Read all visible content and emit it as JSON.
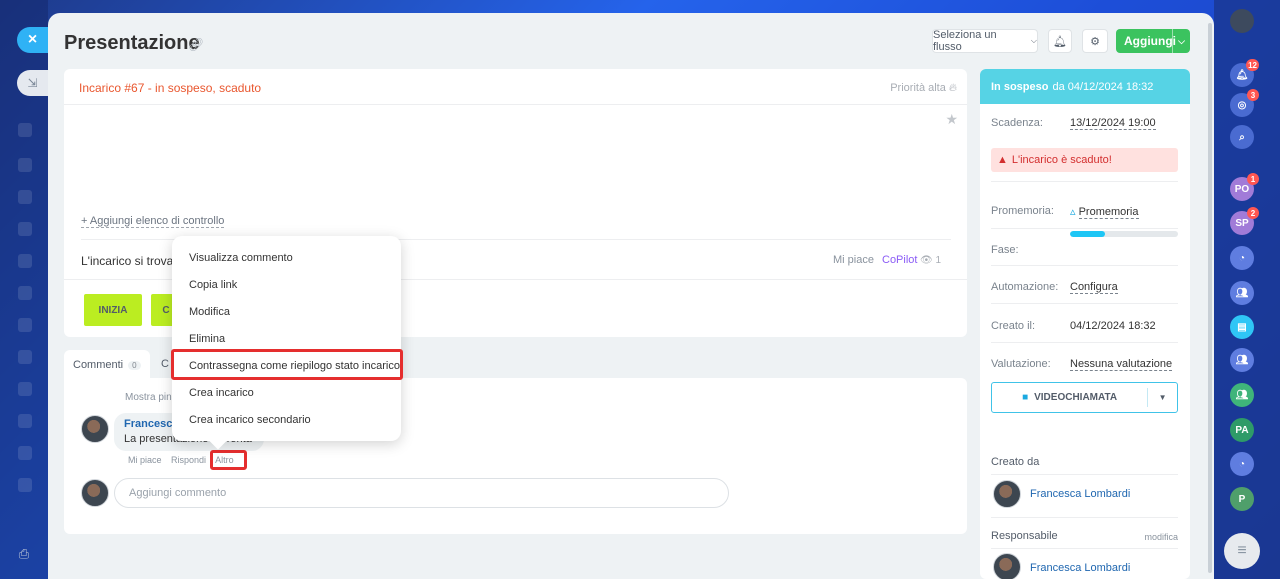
{
  "window": {
    "close_icon": "close-icon",
    "collapse_icon": "collapse-icon"
  },
  "header": {
    "title": "Presentazione",
    "flow_select": "Seleziona un flusso",
    "add_label": "Aggiungi"
  },
  "task": {
    "state": "Incarico #67 - in sospeso, scaduto",
    "priority": "Priorità alta",
    "checklist_link": "+ Aggiungi elenco di controllo",
    "status_text": "L'incarico si trova n",
    "likes": "Mi piace",
    "copilot": "CoPilot",
    "views": "1",
    "start_button": "INIZIA",
    "second_button": "C"
  },
  "context_menu": {
    "items": [
      "Visualizza commento",
      "Copia link",
      "Modifica",
      "Elimina",
      "Contrassegna come riepilogo stato incarico",
      "Crea incarico",
      "Crea incarico secondario"
    ]
  },
  "comments": {
    "tab_label": "Commenti",
    "tab_count": "0",
    "tab_other": "C",
    "show_pinned": "Mostra pin",
    "author": "Francesca",
    "text": "La presentazione è p",
    "text_tail": "ronta",
    "actions": {
      "like": "Mi piace",
      "reply": "Rispondi",
      "more": "Altro"
    },
    "input_placeholder": "Aggiungi commento"
  },
  "sidebar": {
    "status_bold": "In sospeso",
    "status_rest": "da 04/12/2024 18:32",
    "deadline_label": "Scadenza:",
    "deadline_value": "13/12/2024 19:00",
    "overdue": "L'incarico è scaduto!",
    "reminder_label": "Promemoria:",
    "reminder_value": "Promemoria",
    "stage_label": "Fase:",
    "stage_progress": 0.32,
    "automation_label": "Automazione:",
    "automation_value": "Configura",
    "created_label": "Creato il:",
    "created_value": "04/12/2024 18:32",
    "rating_label": "Valutazione:",
    "rating_value": "Nessuna valutazione",
    "video_button": "VIDEOCHIAMATA",
    "created_by_title": "Creato da",
    "created_by": "Francesca Lombardi",
    "responsible_title": "Responsabile",
    "responsible_edit": "modifica",
    "responsible": "Francesca Lombardi"
  },
  "right_rail": {
    "notifications_badge": "12",
    "activity_badge": "3",
    "chat_po_label": "PO",
    "chat_po_badge": "1",
    "chat_sp_label": "SP",
    "chat_sp_badge": "2",
    "chat_pa_label": "PA",
    "chat_p_label": "P"
  },
  "colors": {
    "accent_green": "#3bc35f",
    "start_green": "#bbed21",
    "overdue_red": "#e9572f",
    "status_cyan": "#56d3e5",
    "highlight_red": "#e52e2e"
  }
}
